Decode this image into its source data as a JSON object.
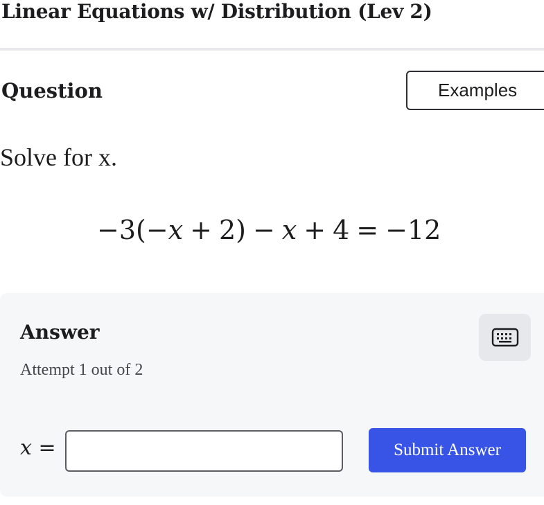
{
  "header": {
    "title": "Linear Equations w/ Distribution (Lev 2)"
  },
  "question": {
    "heading": "Question",
    "examples_label": "Examples",
    "prompt": "Solve for x.",
    "equation": {
      "neg_three": "−3(",
      "neg": "−",
      "x1": "x",
      "plus": "+",
      "two_close": "2)",
      "minus": "−",
      "x2": "x",
      "plus2": "+",
      "four": "4",
      "equals": "=",
      "rhs": "−12"
    }
  },
  "answer": {
    "heading": "Answer",
    "attempt_text": "Attempt 1 out of 2",
    "keyboard_icon": "keyboard-icon",
    "variable": "x",
    "equals": "=",
    "input_value": "",
    "submit_label": "Submit Answer"
  },
  "colors": {
    "primary_button": "#3754e6",
    "panel_background": "#f6f7f9",
    "keyboard_button_background": "#e7e8ec"
  }
}
